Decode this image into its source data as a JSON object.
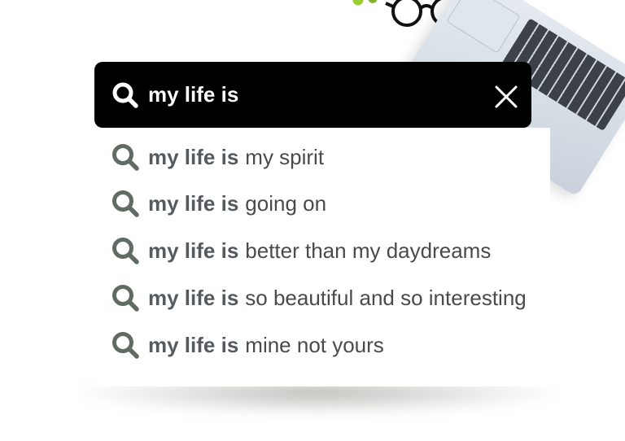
{
  "search": {
    "query": "my life is",
    "icon": "search-icon",
    "clear_icon": "close-icon"
  },
  "suggestions": [
    {
      "prefix": "my life is",
      "completion": "my spirit"
    },
    {
      "prefix": "my life is",
      "completion": "going on"
    },
    {
      "prefix": "my life is",
      "completion": "better than my daydreams"
    },
    {
      "prefix": "my life is",
      "completion": "so beautiful and so interesting"
    },
    {
      "prefix": "my life is",
      "completion": "mine not yours"
    }
  ],
  "colors": {
    "search_bar_bg": "#000000",
    "search_text": "#ffffff",
    "suggestion_icon": "#5f6b63",
    "suggestion_prefix": "#555a5e",
    "suggestion_text": "#4a4a4a"
  }
}
